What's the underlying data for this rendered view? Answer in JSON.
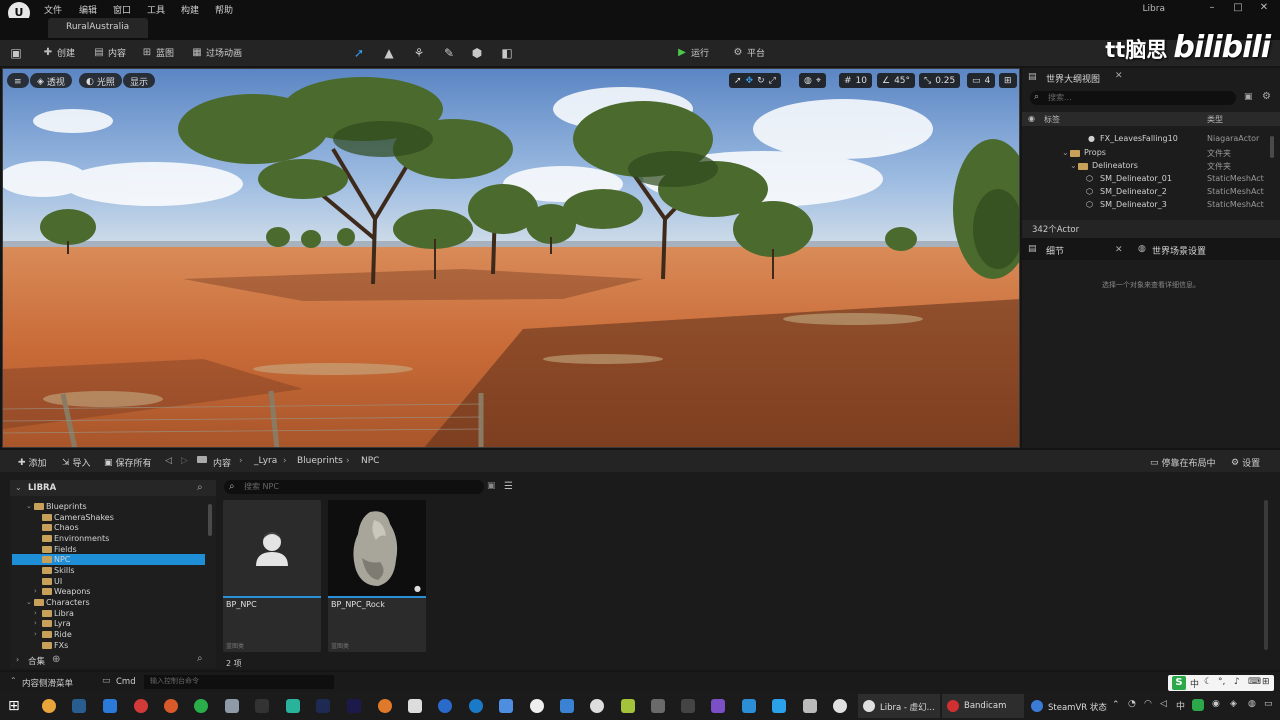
{
  "menubar": {
    "logo": "U",
    "items": [
      "文件",
      "编辑",
      "窗口",
      "工具",
      "构建",
      "帮助"
    ],
    "app_title": "Libra",
    "window_controls": [
      "–",
      "□",
      "✕"
    ]
  },
  "level_tab": {
    "label": "RuralAustralia"
  },
  "toolbar": {
    "save_icon": "save-icon",
    "create_label": "创建",
    "content_label": "内容",
    "blueprint_label": "蓝图",
    "cinematics_label": "过场动画",
    "play_label": "运行",
    "platforms_label": "平台"
  },
  "viewport": {
    "menu_icon": "≡",
    "perspective_label": "透视",
    "lighting_label": "光照",
    "show_label": "显示",
    "grid_snap": "10",
    "angle_snap": "45°",
    "scale_snap": "0.25",
    "camera_speed": "4"
  },
  "watermark": {
    "text1": "tt脑思",
    "text2": "bilibili"
  },
  "outliner": {
    "tab_label": "世界大纲视图",
    "close": "✕",
    "search_placeholder": "搜索...",
    "col_label": "标签",
    "col_type": "类型",
    "rows": [
      {
        "name": "FX_LeavesFalling10",
        "type": "NiagaraActor"
      },
      {
        "name": "Props",
        "type": "文件夹"
      },
      {
        "name": "Delineators",
        "type": "文件夹"
      },
      {
        "name": "SM_Delineator_01",
        "type": "StaticMeshAct"
      },
      {
        "name": "SM_Delineator_2",
        "type": "StaticMeshAct"
      },
      {
        "name": "SM_Delineator_3",
        "type": "StaticMeshAct"
      }
    ],
    "actor_count": "342个Actor"
  },
  "details": {
    "tab_label": "细节",
    "close": "✕",
    "world_settings_label": "世界场景设置",
    "hint": "选择一个对象来查看详细信息。"
  },
  "content_browser": {
    "add_label": "添加",
    "import_label": "导入",
    "save_all_label": "保存所有",
    "breadcrumb": [
      "内容",
      "_Lyra",
      "Blueprints",
      "NPC"
    ],
    "dock_label": "停靠在布局中",
    "settings_label": "设置",
    "tree_root": "LIBRA",
    "tree": [
      {
        "label": "Blueprints",
        "depth": 1,
        "open": true
      },
      {
        "label": "CameraShakes",
        "depth": 2
      },
      {
        "label": "Chaos",
        "depth": 2
      },
      {
        "label": "Environments",
        "depth": 2
      },
      {
        "label": "Fields",
        "depth": 2
      },
      {
        "label": "NPC",
        "depth": 2,
        "selected": true
      },
      {
        "label": "Skills",
        "depth": 2
      },
      {
        "label": "UI",
        "depth": 2
      },
      {
        "label": "Weapons",
        "depth": 2,
        "closed": true
      },
      {
        "label": "Characters",
        "depth": 1,
        "open": true
      },
      {
        "label": "Libra",
        "depth": 2,
        "closed": true
      },
      {
        "label": "Lyra",
        "depth": 2,
        "closed": true
      },
      {
        "label": "Ride",
        "depth": 2,
        "closed": true
      },
      {
        "label": "FXs",
        "depth": 1
      }
    ],
    "collections_label": "合集",
    "search_placeholder": "搜索 NPC",
    "assets": [
      {
        "name": "BP_NPC",
        "type": "蓝图类"
      },
      {
        "name": "BP_NPC_Rock",
        "type": "蓝图类"
      }
    ],
    "item_count": "2 项"
  },
  "statusbar": {
    "drawer_label": "内容侧滑菜单",
    "cmd_label": "Cmd",
    "cmd_placeholder": "输入控制台命令"
  },
  "taskbar": {
    "apps": [
      {
        "label": "Libra - 虚幻...",
        "color": "#e0e0e0"
      },
      {
        "label": "Bandicam",
        "color": "#d03030"
      },
      {
        "label": "SteamVR 状态",
        "color": "#3a7bd5"
      }
    ],
    "tray_lang": "中"
  }
}
